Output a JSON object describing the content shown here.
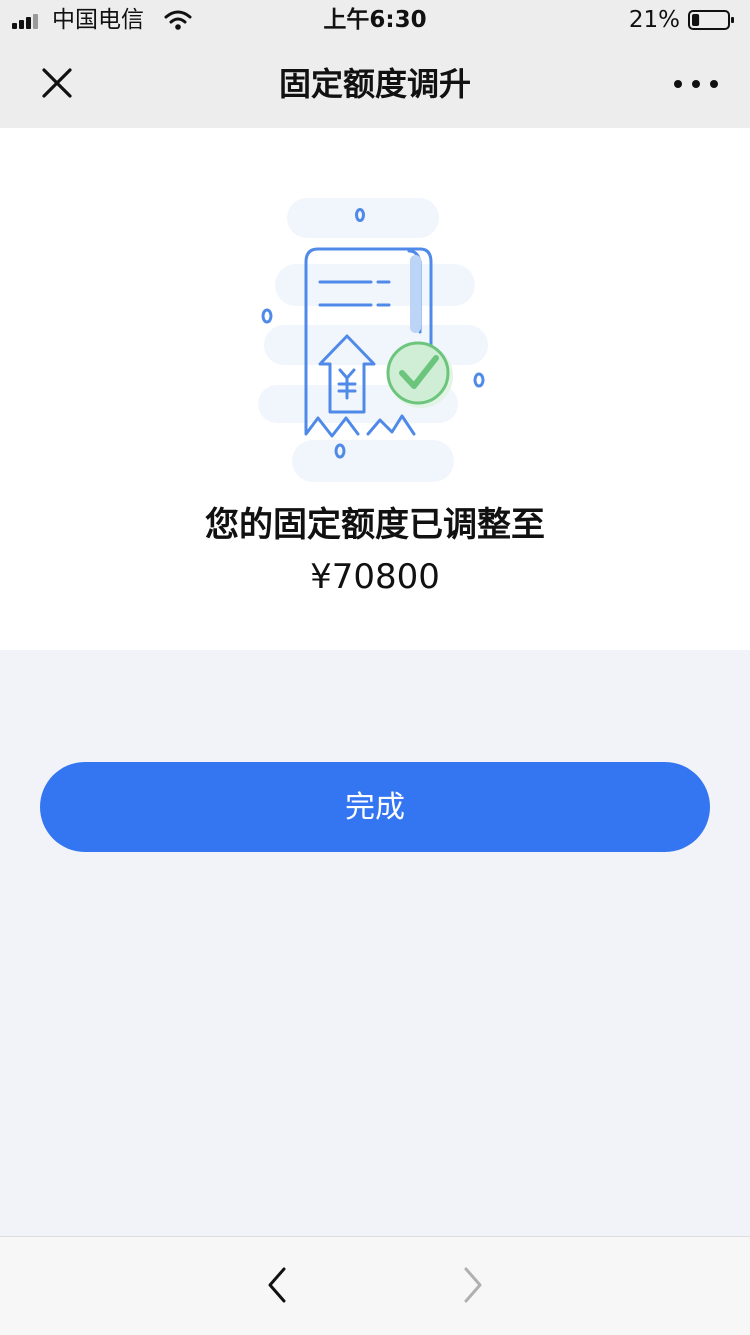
{
  "status_bar": {
    "carrier": "中国电信",
    "time": "上午6:30",
    "battery": "21%",
    "icons": [
      "signal-icon",
      "wifi-icon",
      "battery-icon"
    ]
  },
  "nav": {
    "title": "固定额度调升",
    "icons": [
      "close-icon",
      "more-icon"
    ]
  },
  "result": {
    "message": "您的固定额度已调整至",
    "amount": "¥70800",
    "illustration": "credit-limit-raised-illustration"
  },
  "actions": {
    "done_label": "完成"
  },
  "bottom_bar": {
    "icons": [
      "back-chevron-icon",
      "forward-chevron-icon"
    ]
  },
  "colors": {
    "accent": "#3476f1",
    "success": "#6cc57c",
    "header_bg": "#ededed",
    "page_bg": "#f1f3f8"
  },
  "battery_level": 0.21
}
